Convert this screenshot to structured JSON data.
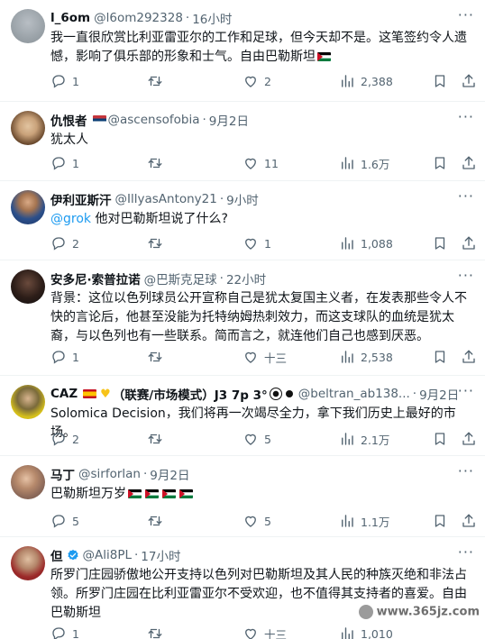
{
  "tweets": [
    {
      "name": "l_6om",
      "handle": "@l6om292328",
      "time": "16小时",
      "body": "我一直很欣赏比利亚雷亚尔的工作和足球，但今天却不是。这笔签约令人遗憾，影响了俱乐部的形象和士气。自由巴勒斯坦",
      "reply": "1",
      "retweet": "",
      "like": "2",
      "views": "2,388"
    },
    {
      "name": "仇恨者",
      "handle": "@ascensofobia",
      "time": "9月2日",
      "body": "犹太人",
      "reply": "1",
      "retweet": "",
      "like": "11",
      "views": "1.6万"
    },
    {
      "name": "伊利亚斯汗",
      "handle": "@IllyasAntony21",
      "time": "9小时",
      "mention": "@grok",
      "body": " 他对巴勒斯坦说了什么?",
      "reply": "2",
      "retweet": "",
      "like": "1",
      "views": "1,088"
    },
    {
      "name": "安多尼·索普拉诺",
      "handle": "@巴斯克足球",
      "time": "22小时",
      "body": "背景：这位以色列球员公开宣称自己是犹太复国主义者，在发表那些令人不快的言论后，他甚至没能为托特纳姆热刺效力，而这支球队的血统是犹太裔，与以色列也有一些联系。简而言之，就连他们自己也感到厌恶。",
      "reply": "1",
      "retweet": "",
      "like": "十三",
      "views": "2,538"
    },
    {
      "name": "CAZ",
      "name_suffix": "（联赛/市场模式）J3 7p 3°",
      "handle": "@beltran_ab138...",
      "time": "9月2日",
      "body": "Solomica Decision，我们将再一次竭尽全力，拿下我们历史上最好的市场。",
      "reply": "2",
      "retweet": "",
      "like": "5",
      "views": "2.1万"
    },
    {
      "name": "马丁",
      "handle": "@sirforlan",
      "time": "9月2日",
      "body": "巴勒斯坦万岁",
      "reply": "5",
      "retweet": "",
      "like": "5",
      "views": "1.1万"
    },
    {
      "name": "但",
      "handle": "@Ali8PL",
      "time": "17小时",
      "body": "所罗门庄园骄傲地公开支持以色列对巴勒斯坦及其人民的种族灭绝和非法占领。所罗门庄园在比利亚雷亚尔不受欢迎，也不值得其支持者的喜爱。自由巴勒斯坦",
      "reply": "1",
      "retweet": "",
      "like": "十三",
      "views": "1,010"
    }
  ],
  "watermark": "www.365jz.com",
  "more_label": "···",
  "colors": {
    "text": "#0f1419",
    "muted": "#536471",
    "link": "#1d9bf0",
    "verified": "#1d9bf0"
  }
}
